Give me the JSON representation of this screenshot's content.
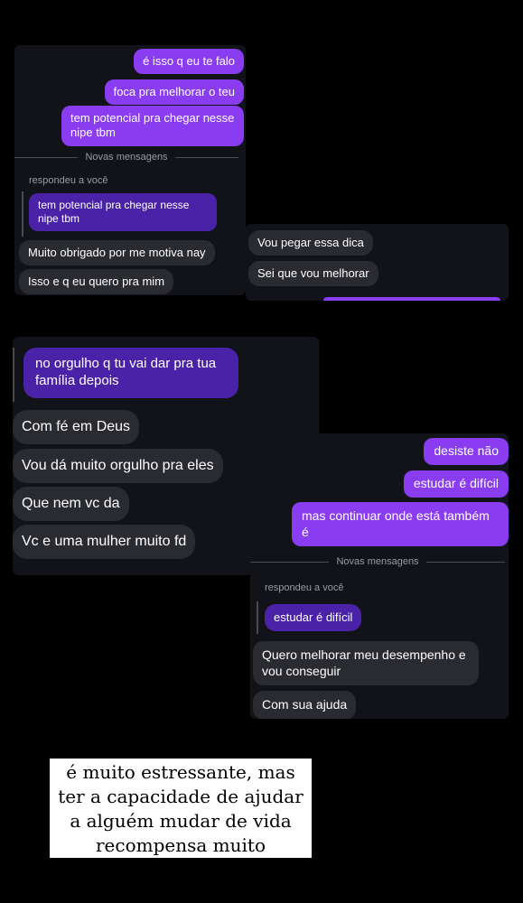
{
  "panel1": {
    "messages": [
      "é isso q eu te falo",
      "foca pra melhorar o teu",
      "tem potencial pra chegar nesse nipe tbm"
    ],
    "divider": "Novas mensagens",
    "reply_label": "respondeu a você",
    "quoted": "tem potencial pra chegar nesse nipe tbm",
    "replies": [
      "Muito obrigado por me motiva nay",
      "Isso e q eu quero pra mim"
    ]
  },
  "panel2": {
    "messages": [
      "Vou pegar essa dica",
      "Sei que vou melhorar"
    ]
  },
  "panel3": {
    "quoted": "no orgulho q tu vai dar pra tua família depois",
    "messages": [
      "Com fé em Deus",
      "Vou dá muito orgulho pra eles",
      "Que nem vc da",
      "Vc e uma mulher muito fd"
    ]
  },
  "panel4": {
    "messages": [
      "desiste não",
      "estudar é difícil",
      "mas continuar onde está também é"
    ],
    "divider": "Novas mensagens",
    "reply_label": "respondeu a você",
    "quoted": "estudar é difícil",
    "replies": [
      "Quero melhorar meu desempenho e vou conseguir",
      "Com sua ajuda"
    ]
  },
  "caption": "é muito estressante, mas ter a capacidade de ajudar a alguém mudar de vida recompensa muito",
  "colors": {
    "sent": "#8a3cf0",
    "received": "#2a2b31",
    "quoted": "#4a22a8",
    "panel": "#111318"
  }
}
